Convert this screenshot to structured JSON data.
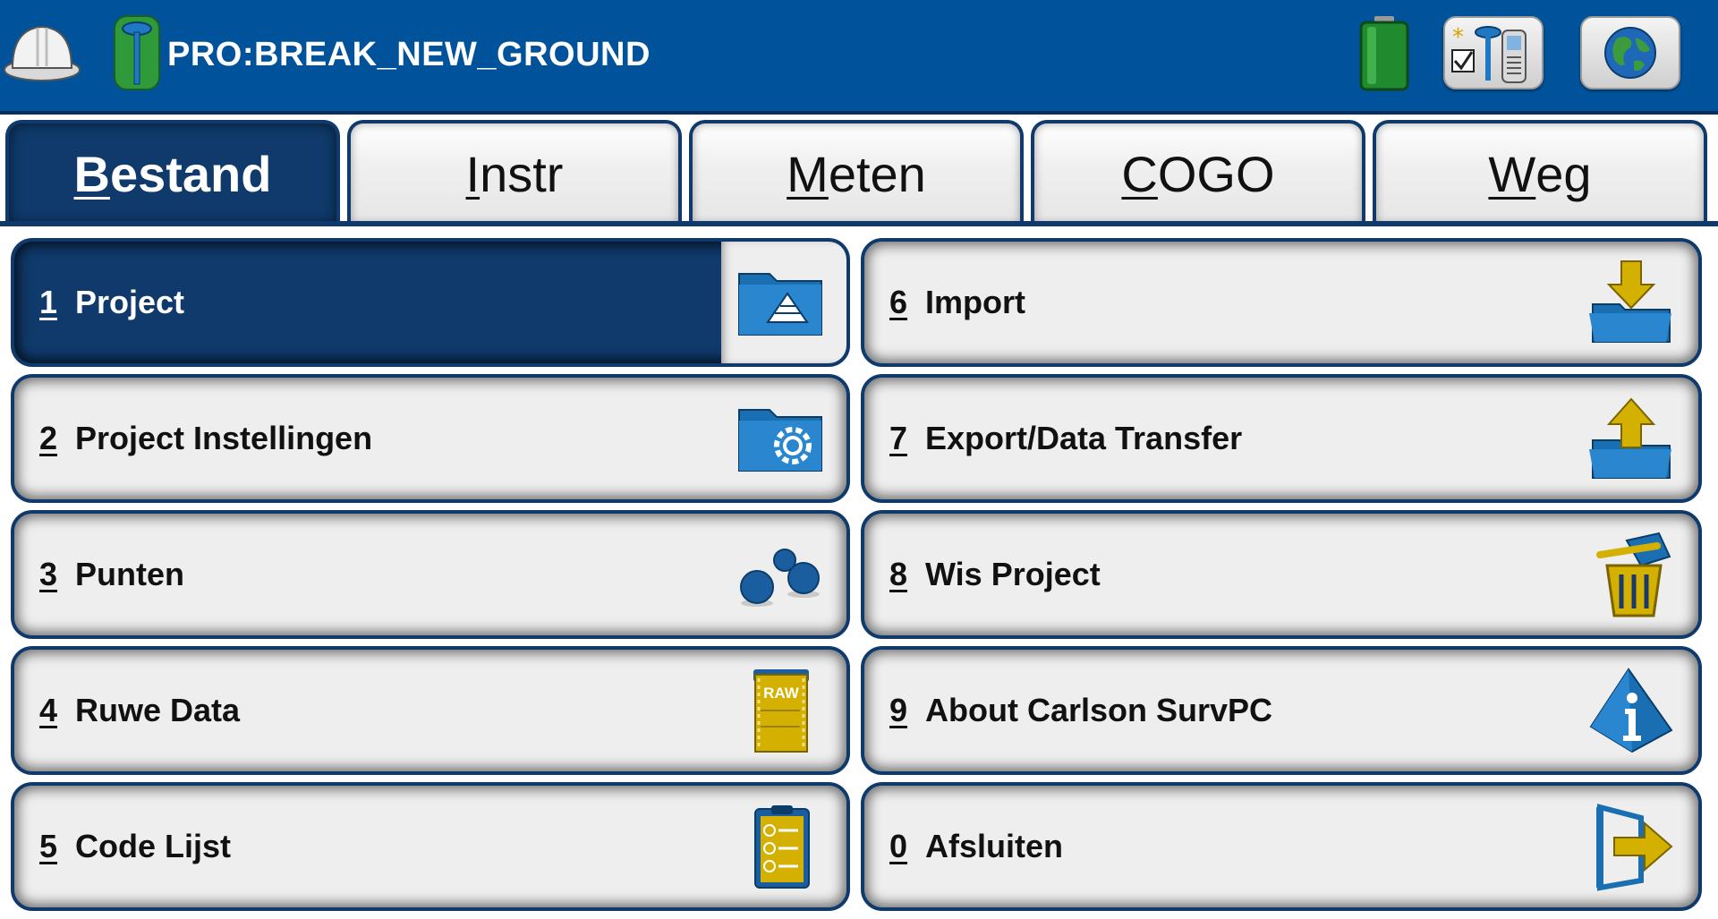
{
  "header": {
    "project_name": "PRO:BREAK_NEW_GROUND"
  },
  "tabs": [
    {
      "label": "Bestand",
      "hotkey_index": 0,
      "active": true
    },
    {
      "label": "Instr",
      "hotkey_index": 0,
      "active": false
    },
    {
      "label": "Meten",
      "hotkey_index": 0,
      "active": false
    },
    {
      "label": "COGO",
      "hotkey_index": 0,
      "active": false
    },
    {
      "label": "Weg",
      "hotkey_index": 0,
      "active": false
    }
  ],
  "menu": {
    "items": [
      {
        "num": "1",
        "label": "Project",
        "icon": "project-folder-icon",
        "selected": true
      },
      {
        "num": "2",
        "label": "Project Instellingen",
        "icon": "folder-settings-icon",
        "selected": false
      },
      {
        "num": "3",
        "label": "Punten",
        "icon": "points-icon",
        "selected": false
      },
      {
        "num": "4",
        "label": "Ruwe Data",
        "icon": "raw-data-icon",
        "selected": false
      },
      {
        "num": "5",
        "label": "Code Lijst",
        "icon": "code-list-icon",
        "selected": false
      },
      {
        "num": "6",
        "label": "Import",
        "icon": "import-icon",
        "selected": false
      },
      {
        "num": "7",
        "label": "Export/Data Transfer",
        "icon": "export-icon",
        "selected": false
      },
      {
        "num": "8",
        "label": "Wis Project",
        "icon": "delete-project-icon",
        "selected": false
      },
      {
        "num": "9",
        "label": "About Carlson SurvPC",
        "icon": "info-icon",
        "selected": false
      },
      {
        "num": "0",
        "label": "Afsluiten",
        "icon": "exit-icon",
        "selected": false
      }
    ],
    "raw_icon_text": "RAW"
  },
  "colors": {
    "header_blue": "#00539b",
    "dark_navy": "#0f3a6b",
    "icon_blue": "#1a6fb3",
    "icon_gold": "#d4b000",
    "button_gray": "#eeeeee"
  }
}
